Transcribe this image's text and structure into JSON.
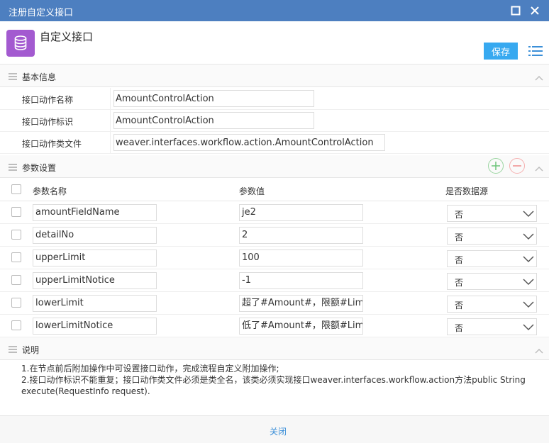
{
  "window": {
    "title": "注册自定义接口"
  },
  "header": {
    "app_title": "自定义接口",
    "save_label": "保存"
  },
  "basic": {
    "section_label": "基本信息",
    "name_label": "接口动作名称",
    "name_value": "AmountControlAction",
    "id_label": "接口动作标识",
    "id_value": "AmountControlAction",
    "class_label": "接口动作类文件",
    "class_value": "weaver.interfaces.workflow.action.AmountControlAction"
  },
  "params": {
    "section_label": "参数设置",
    "columns": {
      "name": "参数名称",
      "value": "参数值",
      "is_datasource": "是否数据源"
    },
    "rows": [
      {
        "name": "amountFieldName",
        "value": "je2",
        "is_datasource": "否"
      },
      {
        "name": "detailNo",
        "value": "2",
        "is_datasource": "否"
      },
      {
        "name": "upperLimit",
        "value": "100",
        "is_datasource": "否"
      },
      {
        "name": "upperLimitNotice",
        "value": "-1",
        "is_datasource": "否"
      },
      {
        "name": "lowerLimit",
        "value": "超了#Amount#，限额#Limit",
        "is_datasource": "否"
      },
      {
        "name": "lowerLimitNotice",
        "value": "低了#Amount#，限额#Limit",
        "is_datasource": "否"
      }
    ]
  },
  "notes": {
    "section_label": "说明",
    "line1": "1.在节点前后附加操作中可设置接口动作，完成流程自定义附加操作;",
    "line2": "2.接口动作标识不能重复；接口动作类文件必须是类全名，该类必须实现接口weaver.interfaces.workflow.action方法public String execute(RequestInfo request)."
  },
  "footer": {
    "close_label": "关闭"
  },
  "colors": {
    "titlebar": "#4d7fc0",
    "accent": "#37a9f0",
    "app_icon": "#a35ad0",
    "link": "#3b8fd8"
  }
}
